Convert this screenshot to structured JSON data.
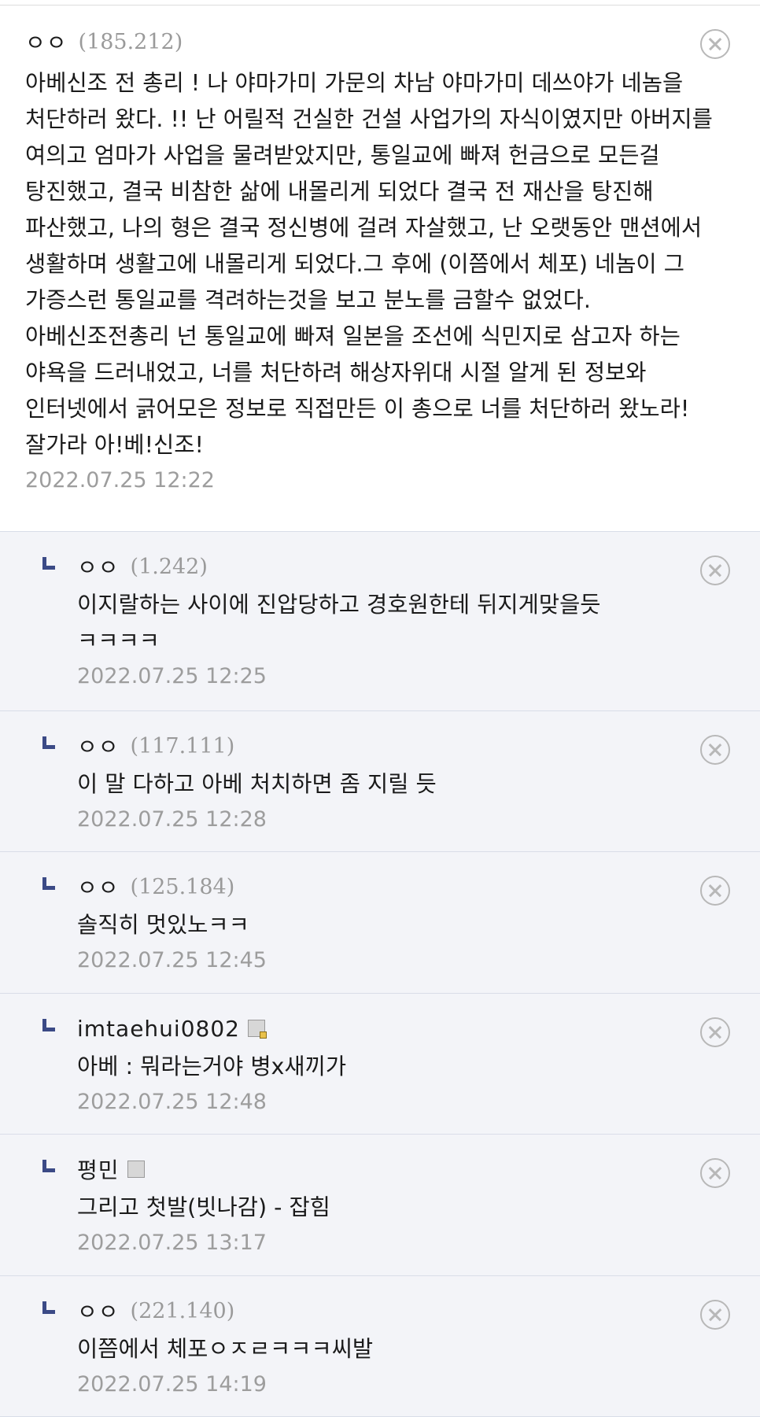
{
  "comments": [
    {
      "nick": "ㅇㅇ",
      "ip": "(185.212)",
      "text": "아베신조 전 총리 ! 나 야마가미 가문의 차남 야마가미 데쓰야가 네놈을 처단하러 왔다. !! 난 어릴적 건실한 건설 사업가의 자식이였지만 아버지를 여의고 엄마가 사업을 물려받았지만, 통일교에 빠져 헌금으로 모든걸 탕진했고, 결국 비참한 삶에 내몰리게 되었다 결국 전 재산을 탕진해 파산했고, 나의 형은 결국 정신병에 걸려 자살했고, 난 오랫동안 맨션에서 생활하며 생활고에 내몰리게 되었다.그 후에 (이쯤에서 체포) 네놈이 그 가증스런 통일교를 격려하는것을 보고 분노를 금할수 없었다. 아베신조전총리 넌 통일교에 빠져 일본을 조선에 식민지로 삼고자 하는 야욕을 드러내었고, 너를 처단하려 해상자위대 시절 알게 된 정보와 인터넷에서 긁어모은 정보로 직접만든 이 총으로 너를 처단하러 왔노라! 잘가라 아!베!신조!",
      "date": "2022.07.25 12:22"
    },
    {
      "nick": "ㅇㅇ",
      "ip": "(1.242)",
      "text": "이지랄하는 사이에 진압당하고 경호원한테 뒤지게맞을듯 ㅋㅋㅋㅋ",
      "date": "2022.07.25 12:25"
    },
    {
      "nick": "ㅇㅇ",
      "ip": "(117.111)",
      "text": "이 말 다하고 아베 처치하면 좀 지릴 듯",
      "date": "2022.07.25 12:28"
    },
    {
      "nick": "ㅇㅇ",
      "ip": "(125.184)",
      "text": "솔직히 멋있노ㅋㅋ",
      "date": "2022.07.25 12:45"
    },
    {
      "nick": "imtaehui0802",
      "ip": "",
      "text": "아베 : 뭐라는거야 병x새끼가",
      "date": "2022.07.25 12:48"
    },
    {
      "nick": "평민",
      "ip": "",
      "text": "그리고 첫발(빗나감) - 잡힘",
      "date": "2022.07.25 13:17"
    },
    {
      "nick": "ㅇㅇ",
      "ip": "(221.140)",
      "text": "이쯤에서 체포ㅇㅈㄹㅋㅋㅋ씨발",
      "date": "2022.07.25 14:19"
    }
  ]
}
